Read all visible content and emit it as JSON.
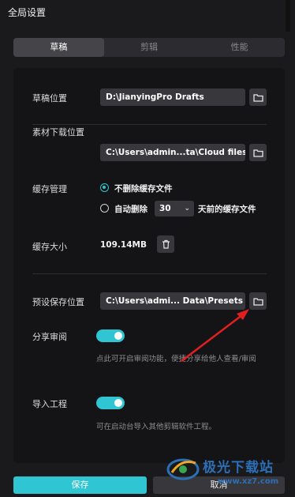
{
  "window": {
    "title": "全局设置"
  },
  "tabs": [
    {
      "label": "草稿",
      "active": true
    },
    {
      "label": "剪辑",
      "active": false
    },
    {
      "label": "性能",
      "active": false
    }
  ],
  "draft_location": {
    "label": "草稿位置",
    "value": "D:\\JianyingPro Drafts",
    "icon": "folder-icon"
  },
  "material_download": {
    "label": "素材下载位置",
    "value": "C:\\Users\\admin...ta\\Cloud files",
    "icon": "folder-icon"
  },
  "cache_management": {
    "label": "缓存管理",
    "option_keep": "不删除缓存文件",
    "option_auto": "自动删除",
    "days_value": "30",
    "days_suffix": "天前的缓存文件",
    "selected": "不删除缓存文件"
  },
  "cache_size": {
    "label": "缓存大小",
    "value": "109.14MB",
    "icon": "trash-icon"
  },
  "preset_location": {
    "label": "预设保存位置",
    "value": "C:\\Users\\admi... Data\\Presets",
    "icon": "folder-icon"
  },
  "share_review": {
    "label": "分享审阅",
    "enabled": true,
    "hint": "点此可开启审阅功能，便捷分享给他人查看/审阅"
  },
  "import_project": {
    "label": "导入工程",
    "enabled": true,
    "hint": "可在启动台导入其他剪辑软件工程。"
  },
  "footer": {
    "save_label": "保存",
    "cancel_label": "取消"
  },
  "watermark": {
    "brand": "极光下载站",
    "url": "www.xz7.com"
  },
  "colors": {
    "accent": "#2fc5d2",
    "annotation_arrow": "#e02020",
    "background": "#1a1a1c"
  }
}
